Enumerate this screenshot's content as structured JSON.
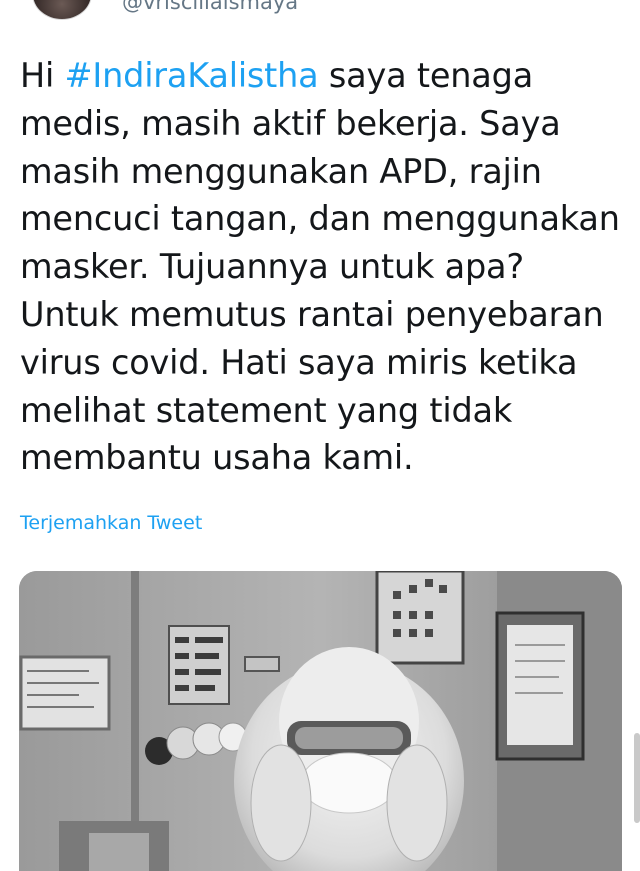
{
  "tweet": {
    "handle": "@vrisciliaismaya",
    "text_intro": "Hi ",
    "hashtag": "#IndiraKalistha",
    "text_body": " saya tenaga medis, masih aktif bekerja. Saya masih menggunakan APD, rajin mencuci tangan, dan menggunakan masker. Tujuannya untuk apa? Untuk memutus rantai penyebaran virus covid. Hati saya miris ketika melihat statement yang tidak membantu usaha kami.",
    "translate_label": "Terjemahkan Tweet"
  },
  "colors": {
    "link": "#1da1f2",
    "handle": "#657786",
    "text": "#14171a"
  },
  "icons": {
    "scrollbar": "scrollbar-thumb"
  }
}
